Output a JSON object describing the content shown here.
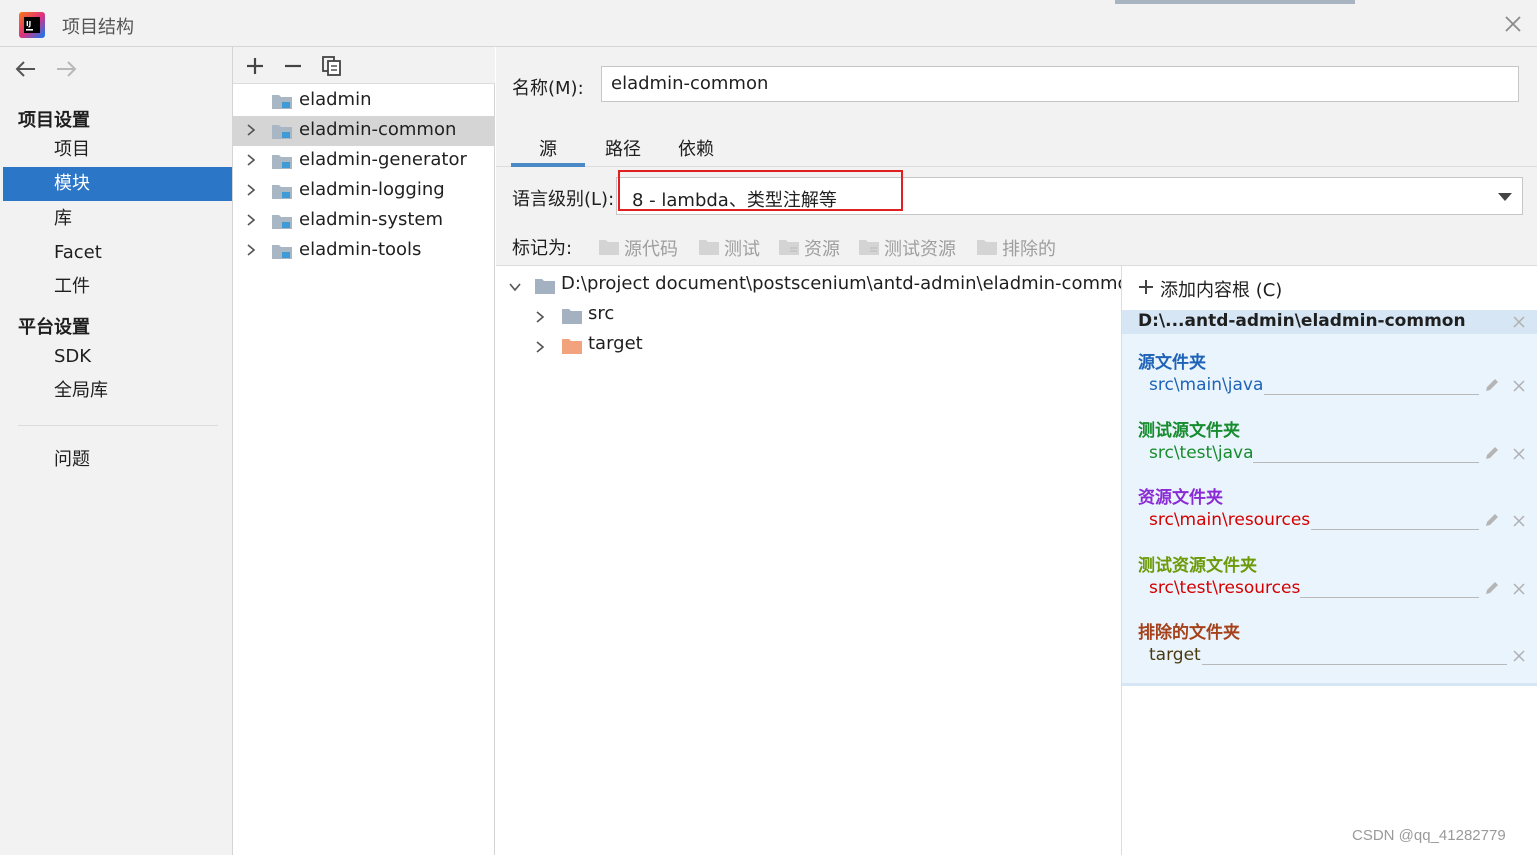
{
  "window": {
    "title": "项目结构",
    "close_icon": "close-icon"
  },
  "nav": {
    "back_icon": "arrow-left-icon",
    "forward_icon": "arrow-right-icon",
    "project_settings_header": "项目设置",
    "platform_settings_header": "平台设置",
    "items": [
      {
        "label": "项目"
      },
      {
        "label": "模块",
        "selected": true
      },
      {
        "label": "库"
      },
      {
        "label": "Facet"
      },
      {
        "label": "工件"
      },
      {
        "label": "SDK"
      },
      {
        "label": "全局库"
      },
      {
        "label": "问题"
      }
    ]
  },
  "modules": {
    "toolbar_icons": [
      "plus-icon",
      "minus-icon",
      "copy-icon"
    ],
    "items": [
      {
        "label": "eladmin",
        "expandable": false
      },
      {
        "label": "eladmin-common",
        "expandable": true,
        "selected": true
      },
      {
        "label": "eladmin-generator",
        "expandable": true
      },
      {
        "label": "eladmin-logging",
        "expandable": true
      },
      {
        "label": "eladmin-system",
        "expandable": true
      },
      {
        "label": "eladmin-tools",
        "expandable": true
      }
    ]
  },
  "main": {
    "name_label": "名称(M):",
    "name_value": "eladmin-common",
    "tabs": [
      {
        "label": "源",
        "active": true
      },
      {
        "label": "路径"
      },
      {
        "label": "依赖"
      }
    ],
    "language_label": "语言级别(L):",
    "language_value": "8 - lambda、类型注解等",
    "mark_as_label": "标记为:",
    "mark_buttons": [
      {
        "label": "源代码"
      },
      {
        "label": "测试"
      },
      {
        "label": "资源"
      },
      {
        "label": "测试资源"
      },
      {
        "label": "排除的"
      }
    ]
  },
  "tree": {
    "root": "D:\\project document\\postscenium\\antd-admin\\eladmin-common",
    "children": [
      {
        "label": "src",
        "color": "#a3b1c0"
      },
      {
        "label": "target",
        "color": "#f2a27c"
      }
    ]
  },
  "roots": {
    "add_label": "添加内容根 (C)",
    "path": "D:\\...antd-admin\\eladmin-common",
    "groups": [
      {
        "title": "源文件夹",
        "path": "src\\main\\java",
        "title_color": "#1e63b8",
        "path_color": "#1e63b8"
      },
      {
        "title": "测试源文件夹",
        "path": "src\\test\\java",
        "title_color": "#168c2e",
        "path_color": "#168c2e"
      },
      {
        "title": "资源文件夹",
        "path": "src\\main\\resources",
        "title_color": "#8a2bd6",
        "path_color": "#d40000"
      },
      {
        "title": "测试资源文件夹",
        "path": "src\\test\\resources",
        "title_color": "#6c9a08",
        "path_color": "#d40000"
      },
      {
        "title": "排除的文件夹",
        "path": "target",
        "title_color": "#a6421b",
        "path_color": "#4a3a10"
      }
    ]
  },
  "watermark": "CSDN @qq_41282779"
}
